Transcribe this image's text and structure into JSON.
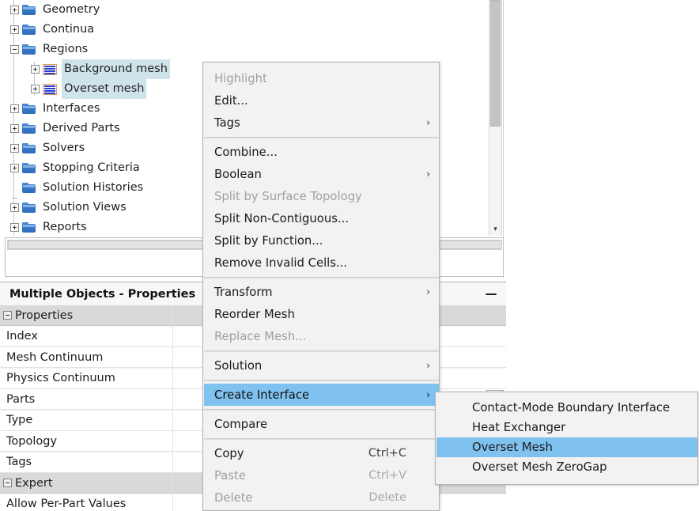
{
  "tree": {
    "name": "simulation-tree",
    "items": [
      {
        "label": "Geometry",
        "indent": 0,
        "expander": "plus",
        "icon": "folder-icon",
        "selected": false
      },
      {
        "label": "Continua",
        "indent": 0,
        "expander": "plus",
        "icon": "folder-icon",
        "selected": false
      },
      {
        "label": "Regions",
        "indent": 0,
        "expander": "minus",
        "icon": "folder-icon",
        "selected": false
      },
      {
        "label": "Background mesh",
        "indent": 1,
        "expander": "plus",
        "icon": "mesh-region-icon",
        "selected": true
      },
      {
        "label": "Overset mesh",
        "indent": 1,
        "expander": "plus",
        "icon": "mesh-region-icon",
        "selected": true
      },
      {
        "label": "Interfaces",
        "indent": 0,
        "expander": "plus",
        "icon": "folder-icon",
        "selected": false
      },
      {
        "label": "Derived Parts",
        "indent": 0,
        "expander": "plus",
        "icon": "folder-icon",
        "selected": false
      },
      {
        "label": "Solvers",
        "indent": 0,
        "expander": "plus",
        "icon": "folder-icon",
        "selected": false
      },
      {
        "label": "Stopping Criteria",
        "indent": 0,
        "expander": "plus",
        "icon": "folder-icon",
        "selected": false
      },
      {
        "label": "Solution Histories",
        "indent": 0,
        "expander": "none",
        "icon": "folder-icon",
        "selected": false
      },
      {
        "label": "Solution Views",
        "indent": 0,
        "expander": "plus",
        "icon": "folder-icon",
        "selected": false
      },
      {
        "label": "Reports",
        "indent": 0,
        "expander": "plus",
        "icon": "folder-icon",
        "selected": false
      }
    ],
    "scrollbar": {
      "down_arrow": "▾"
    }
  },
  "context_menu": {
    "items": [
      {
        "label": "Highlight",
        "disabled": true,
        "submenu": false,
        "shortcut": "",
        "highlighted": false,
        "sep_after": false
      },
      {
        "label": "Edit...",
        "disabled": false,
        "submenu": false,
        "shortcut": "",
        "highlighted": false,
        "sep_after": false
      },
      {
        "label": "Tags",
        "disabled": false,
        "submenu": true,
        "shortcut": "",
        "highlighted": false,
        "sep_after": true
      },
      {
        "label": "Combine...",
        "disabled": false,
        "submenu": false,
        "shortcut": "",
        "highlighted": false,
        "sep_after": false
      },
      {
        "label": "Boolean",
        "disabled": false,
        "submenu": true,
        "shortcut": "",
        "highlighted": false,
        "sep_after": false
      },
      {
        "label": "Split by Surface Topology",
        "disabled": true,
        "submenu": false,
        "shortcut": "",
        "highlighted": false,
        "sep_after": false
      },
      {
        "label": "Split Non-Contiguous...",
        "disabled": false,
        "submenu": false,
        "shortcut": "",
        "highlighted": false,
        "sep_after": false
      },
      {
        "label": "Split by Function...",
        "disabled": false,
        "submenu": false,
        "shortcut": "",
        "highlighted": false,
        "sep_after": false
      },
      {
        "label": "Remove Invalid Cells...",
        "disabled": false,
        "submenu": false,
        "shortcut": "",
        "highlighted": false,
        "sep_after": true
      },
      {
        "label": "Transform",
        "disabled": false,
        "submenu": true,
        "shortcut": "",
        "highlighted": false,
        "sep_after": false
      },
      {
        "label": "Reorder Mesh",
        "disabled": false,
        "submenu": false,
        "shortcut": "",
        "highlighted": false,
        "sep_after": false
      },
      {
        "label": "Replace Mesh...",
        "disabled": true,
        "submenu": false,
        "shortcut": "",
        "highlighted": false,
        "sep_after": true
      },
      {
        "label": "Solution",
        "disabled": false,
        "submenu": true,
        "shortcut": "",
        "highlighted": false,
        "sep_after": true
      },
      {
        "label": "Create Interface",
        "disabled": false,
        "submenu": true,
        "shortcut": "",
        "highlighted": true,
        "sep_after": true
      },
      {
        "label": "Compare",
        "disabled": false,
        "submenu": false,
        "shortcut": "",
        "highlighted": false,
        "sep_after": true
      },
      {
        "label": "Copy",
        "disabled": false,
        "submenu": false,
        "shortcut": "Ctrl+C",
        "highlighted": false,
        "sep_after": false
      },
      {
        "label": "Paste",
        "disabled": true,
        "submenu": false,
        "shortcut": "Ctrl+V",
        "highlighted": false,
        "sep_after": false
      },
      {
        "label": "Delete",
        "disabled": true,
        "submenu": false,
        "shortcut": "Delete",
        "highlighted": false,
        "sep_after": false
      }
    ],
    "submenu_arrow": "›"
  },
  "submenu": {
    "title": "create-interface-submenu",
    "items": [
      {
        "label": "Contact-Mode Boundary Interface",
        "highlighted": false
      },
      {
        "label": "Heat Exchanger",
        "highlighted": false
      },
      {
        "label": "Overset Mesh",
        "highlighted": true
      },
      {
        "label": "Overset Mesh ZeroGap",
        "highlighted": false
      }
    ]
  },
  "properties_panel": {
    "title": "Multiple Objects - Properties",
    "minimize_glyph": "—",
    "rows": [
      {
        "name": "Properties",
        "group": true,
        "value": "",
        "ellipsis": false
      },
      {
        "name": "Index",
        "group": false,
        "value": "",
        "ellipsis": false
      },
      {
        "name": "Mesh Continuum",
        "group": false,
        "value": "",
        "ellipsis": false
      },
      {
        "name": "Physics Continuum",
        "group": false,
        "value": "",
        "ellipsis": false
      },
      {
        "name": "Parts",
        "group": false,
        "value": "",
        "ellipsis": true
      },
      {
        "name": "Type",
        "group": false,
        "value": "",
        "ellipsis": true
      },
      {
        "name": "Topology",
        "group": false,
        "value": "",
        "ellipsis": false
      },
      {
        "name": "Tags",
        "group": false,
        "value": "",
        "ellipsis": false
      },
      {
        "name": "Expert",
        "group": true,
        "value": "",
        "ellipsis": false
      },
      {
        "name": "Allow Per-Part Values",
        "group": false,
        "value": "",
        "ellipsis": false
      }
    ],
    "ellipsis_label": "•••"
  },
  "colors": {
    "selection_blue": "#7fc1ef",
    "tree_selection": "#cfe4ea",
    "menu_bg": "#f2f2f2",
    "group_row": "#d9d9d9",
    "folder_blue": "#3f7fd0",
    "mesh_line_blue": "#2c3fd0",
    "mesh_border_orange": "#d79a5b"
  }
}
